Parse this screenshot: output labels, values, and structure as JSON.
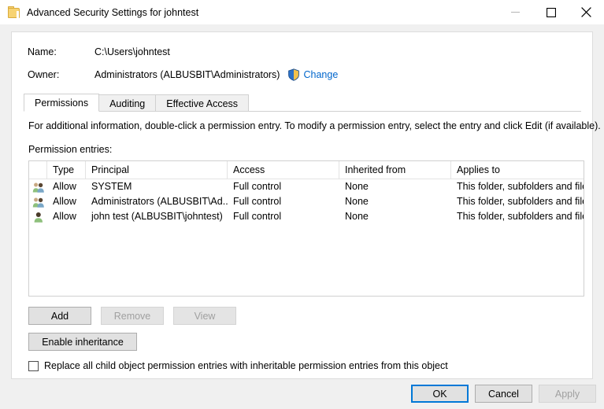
{
  "window": {
    "title": "Advanced Security Settings for johntest",
    "icon": "folder-icon",
    "minimize_label": "—",
    "maximize_label": "□",
    "close_label": "✕"
  },
  "header": {
    "name_label": "Name:",
    "name_value": "C:\\Users\\johntest",
    "owner_label": "Owner:",
    "owner_value": "Administrators (ALBUSBIT\\Administrators)",
    "change_link": "Change",
    "change_icon": "uac-shield-icon"
  },
  "tabs": [
    {
      "label": "Permissions",
      "active": true
    },
    {
      "label": "Auditing",
      "active": false
    },
    {
      "label": "Effective Access",
      "active": false
    }
  ],
  "main": {
    "info_text": "For additional information, double-click a permission entry. To modify a permission entry, select the entry and click Edit (if available).",
    "entries_label": "Permission entries:"
  },
  "table": {
    "columns": [
      "",
      "Type",
      "Principal",
      "Access",
      "Inherited from",
      "Applies to"
    ],
    "rows": [
      {
        "icon": "group-icon",
        "type": "Allow",
        "principal": "SYSTEM",
        "access": "Full control",
        "inherited_from": "None",
        "applies_to": "This folder, subfolders and files"
      },
      {
        "icon": "group-icon",
        "type": "Allow",
        "principal": "Administrators (ALBUSBIT\\Ad...",
        "access": "Full control",
        "inherited_from": "None",
        "applies_to": "This folder, subfolders and files"
      },
      {
        "icon": "user-icon",
        "type": "Allow",
        "principal": "john test (ALBUSBIT\\johntest)",
        "access": "Full control",
        "inherited_from": "None",
        "applies_to": "This folder, subfolders and files"
      }
    ]
  },
  "actions": {
    "add": "Add",
    "remove": "Remove",
    "view": "View",
    "enable_inheritance": "Enable inheritance",
    "replace_checkbox_label": "Replace all child object permission entries with inheritable permission entries from this object",
    "replace_checked": false
  },
  "footer": {
    "ok": "OK",
    "cancel": "Cancel",
    "apply": "Apply"
  },
  "colors": {
    "accent": "#0078d7",
    "link": "#0066cc",
    "shield_blue": "#2b71c8",
    "shield_yellow": "#f2c14a",
    "folder_yellow": "#f7d372",
    "dialog_bg": "#f0f0f0",
    "panel_bg": "#ffffff"
  }
}
